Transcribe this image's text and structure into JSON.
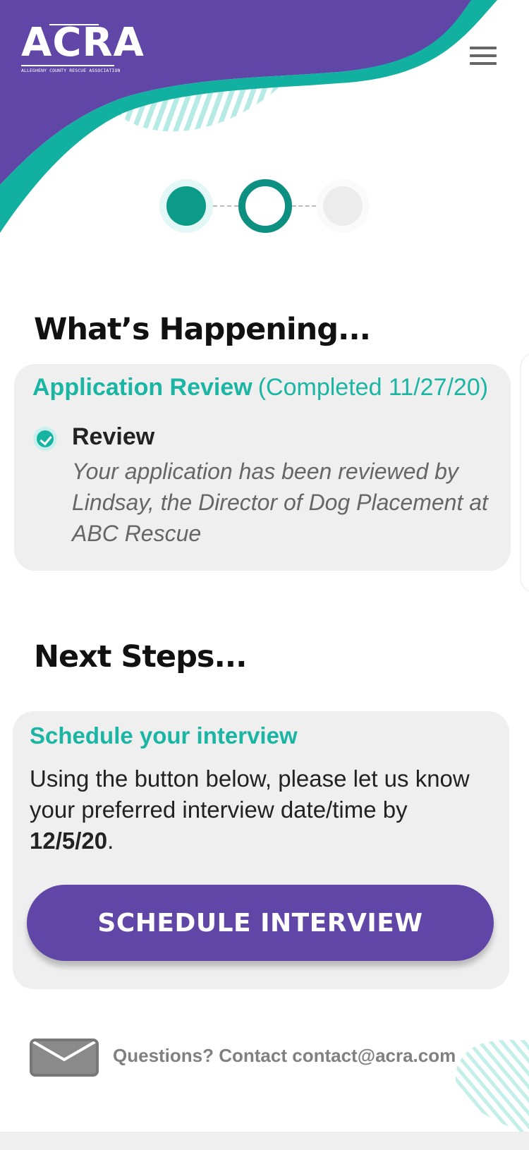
{
  "brand": {
    "logo_text": "ACRA",
    "logo_subtitle": "ALLEGHENY COUNTY RESCUE ASSOCIATION",
    "colors": {
      "purple": "#5f46a7",
      "teal": "#12b0a0",
      "teal_dark": "#0d8f81",
      "card_bg": "#efefef"
    }
  },
  "header": {
    "menu_icon": "hamburger-menu-icon"
  },
  "progress": {
    "current_step": 2,
    "total_steps": 3
  },
  "whats_happening": {
    "heading": "What’s Happening...",
    "card": {
      "title": "Application Review",
      "status": "(Completed 11/27/20)",
      "item": {
        "icon": "check-circle-icon",
        "label": "Review",
        "description": "Your application has been reviewed by Lindsay, the Director of Dog Placement at ABC Rescue"
      }
    }
  },
  "next_steps": {
    "heading": "Next Steps...",
    "card": {
      "title": "Schedule your interview",
      "description_prefix": "Using the button below, please let us know your preferred interview date/time by ",
      "deadline": "12/5/20",
      "description_suffix": ".",
      "button_label": "SCHEDULE INTERVIEW"
    }
  },
  "footer": {
    "mail_icon": "envelope-icon",
    "contact_prefix": "Questions? Contact ",
    "contact_email": "contact@acra.com"
  }
}
